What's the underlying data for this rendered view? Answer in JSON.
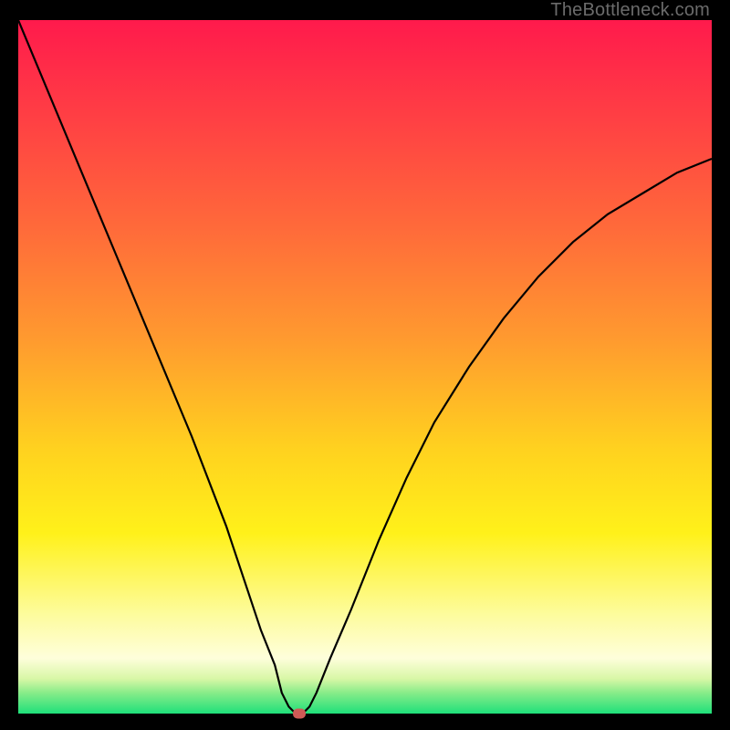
{
  "watermark": "TheBottleneck.com",
  "chart_data": {
    "type": "line",
    "title": "",
    "xlabel": "",
    "ylabel": "",
    "xlim": [
      0,
      100
    ],
    "ylim": [
      0,
      100
    ],
    "grid": false,
    "legend": false,
    "background_gradient": {
      "stops": [
        {
          "pct": 0,
          "color": "#ff1a4c"
        },
        {
          "pct": 14,
          "color": "#ff3f44"
        },
        {
          "pct": 30,
          "color": "#ff6a3a"
        },
        {
          "pct": 46,
          "color": "#ff9a2f"
        },
        {
          "pct": 62,
          "color": "#ffd21f"
        },
        {
          "pct": 74,
          "color": "#fff11a"
        },
        {
          "pct": 86,
          "color": "#fdfca0"
        },
        {
          "pct": 92,
          "color": "#fefedb"
        },
        {
          "pct": 95,
          "color": "#d8f7a6"
        },
        {
          "pct": 97,
          "color": "#88ec89"
        },
        {
          "pct": 100,
          "color": "#1fe07a"
        }
      ]
    },
    "series": [
      {
        "name": "bottleneck-curve",
        "color": "#000000",
        "x": [
          0,
          5,
          10,
          15,
          20,
          25,
          30,
          33,
          35,
          37,
          38,
          39,
          40,
          41,
          42,
          43,
          45,
          48,
          52,
          56,
          60,
          65,
          70,
          75,
          80,
          85,
          90,
          95,
          100
        ],
        "y": [
          100,
          88,
          76,
          64,
          52,
          40,
          27,
          18,
          12,
          7,
          3,
          1,
          0,
          0,
          1,
          3,
          8,
          15,
          25,
          34,
          42,
          50,
          57,
          63,
          68,
          72,
          75,
          78,
          80
        ]
      }
    ],
    "marker": {
      "x": 40.5,
      "y": 0,
      "color": "#cf5a56"
    }
  }
}
